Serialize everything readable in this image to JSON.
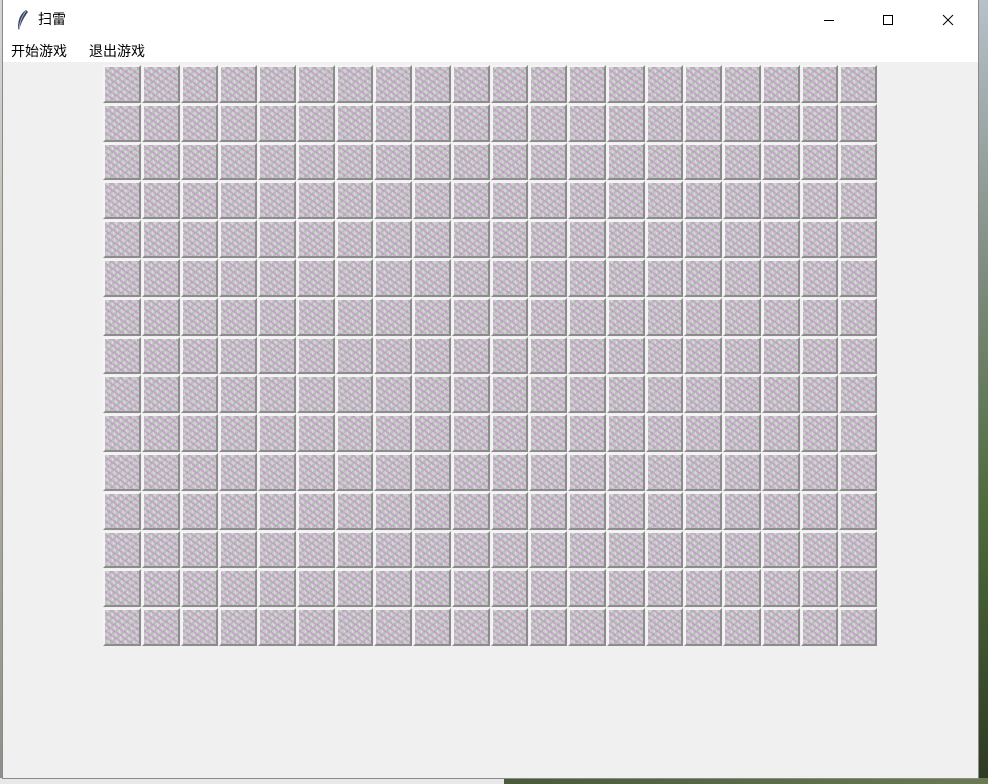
{
  "window": {
    "title": "扫雷",
    "icon": "feather-icon",
    "controls": [
      "minimize-icon",
      "maximize-icon",
      "close-icon"
    ]
  },
  "menu": {
    "items": [
      {
        "label": "开始游戏"
      },
      {
        "label": "退出游戏"
      }
    ]
  },
  "board": {
    "rows": 15,
    "cols": 20,
    "cell_state": "unrevealed"
  },
  "colors": {
    "window_bg": "#f0f0f0",
    "titlebar_bg": "#ffffff",
    "cell_face": "#ccc8cc",
    "cell_pattern_pink": "#c478c8",
    "cell_pattern_green": "#78be82"
  }
}
